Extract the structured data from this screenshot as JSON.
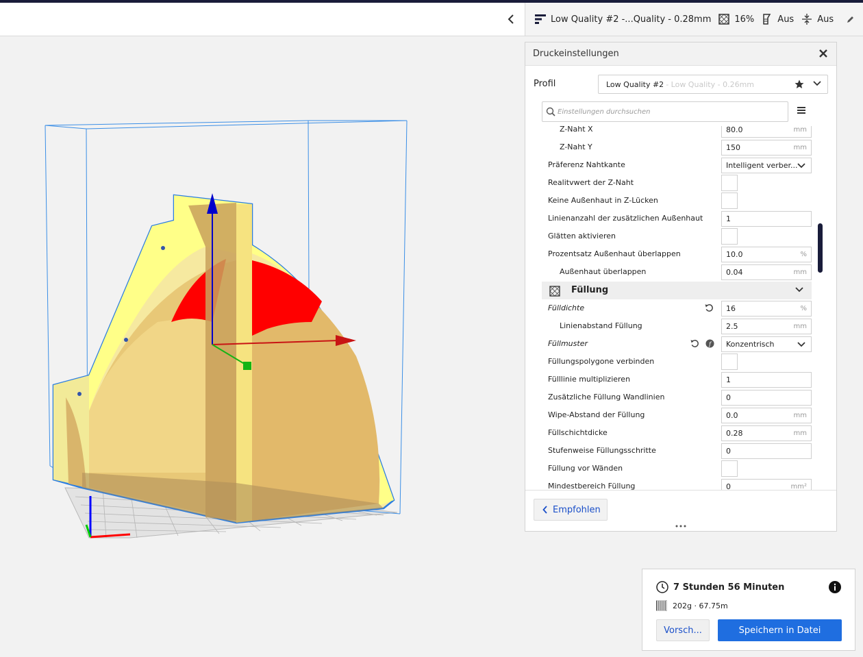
{
  "header": {
    "profile_summary": "Low Quality #2 -...Quality - 0.28mm",
    "infill": "16%",
    "support": "Aus",
    "adhesion": "Aus"
  },
  "panel": {
    "title": "Druckeinstellungen",
    "profile_label": "Profil",
    "profile_name": "Low Quality #2",
    "profile_sub": "- Low Quality - 0.26mm",
    "search_placeholder": "Einstellungen durchsuchen",
    "recommended_label": "Empfohlen"
  },
  "settings": {
    "z_seam_x": {
      "label": "Z-Naht X",
      "value": "80.0",
      "unit": "mm"
    },
    "z_seam_y": {
      "label": "Z-Naht Y",
      "value": "150",
      "unit": "mm"
    },
    "seam_corner": {
      "label": "Präferenz Nahtkante",
      "value": "Intelligent verber..."
    },
    "seam_relative": {
      "label": "Realitvwert der Z-Naht"
    },
    "no_skin_gaps": {
      "label": "Keine Außenhaut in Z-Lücken"
    },
    "extra_skin_lines": {
      "label": "Linienanzahl der zusätzlichen Außenhaut",
      "value": "1"
    },
    "ironing": {
      "label": "Glätten aktivieren"
    },
    "skin_overlap_pct": {
      "label": "Prozentsatz Außenhaut überlappen",
      "value": "10.0",
      "unit": "%"
    },
    "skin_overlap": {
      "label": "Außenhaut überlappen",
      "value": "0.04",
      "unit": "mm"
    },
    "infill_category": {
      "label": "Füllung"
    },
    "infill_density": {
      "label": "Fülldichte",
      "value": "16",
      "unit": "%"
    },
    "infill_line_distance": {
      "label": "Linienabstand Füllung",
      "value": "2.5",
      "unit": "mm"
    },
    "infill_pattern": {
      "label": "Füllmuster",
      "value": "Konzentrisch"
    },
    "connect_polygons": {
      "label": "Füllungspolygone verbinden"
    },
    "infill_multiplier": {
      "label": "Fülllinie multiplizieren",
      "value": "1"
    },
    "extra_wall_lines": {
      "label": "Zusätzliche Füllung Wandlinien",
      "value": "0"
    },
    "wipe_distance": {
      "label": "Wipe-Abstand der Füllung",
      "value": "0.0",
      "unit": "mm"
    },
    "layer_thickness": {
      "label": "Füllschichtdicke",
      "value": "0.28",
      "unit": "mm"
    },
    "gradual_steps": {
      "label": "Stufenweise Füllungsschritte",
      "value": "0"
    },
    "infill_before_walls": {
      "label": "Füllung vor Wänden"
    },
    "min_infill_area": {
      "label": "Mindestbereich Füllung",
      "value": "0",
      "unit": "mm²"
    }
  },
  "print": {
    "time": "7 Stunden 56 Minuten",
    "material": "202g · 67.75m",
    "preview_label": "Vorsch...",
    "save_label": "Speichern in Datei"
  },
  "colors": {
    "accent": "#191c3a",
    "primary_button": "#1f6ee0",
    "model_yellow": "#ffff88",
    "overhang_red": "#ff0000",
    "bbox_blue": "#3a8ee6"
  }
}
